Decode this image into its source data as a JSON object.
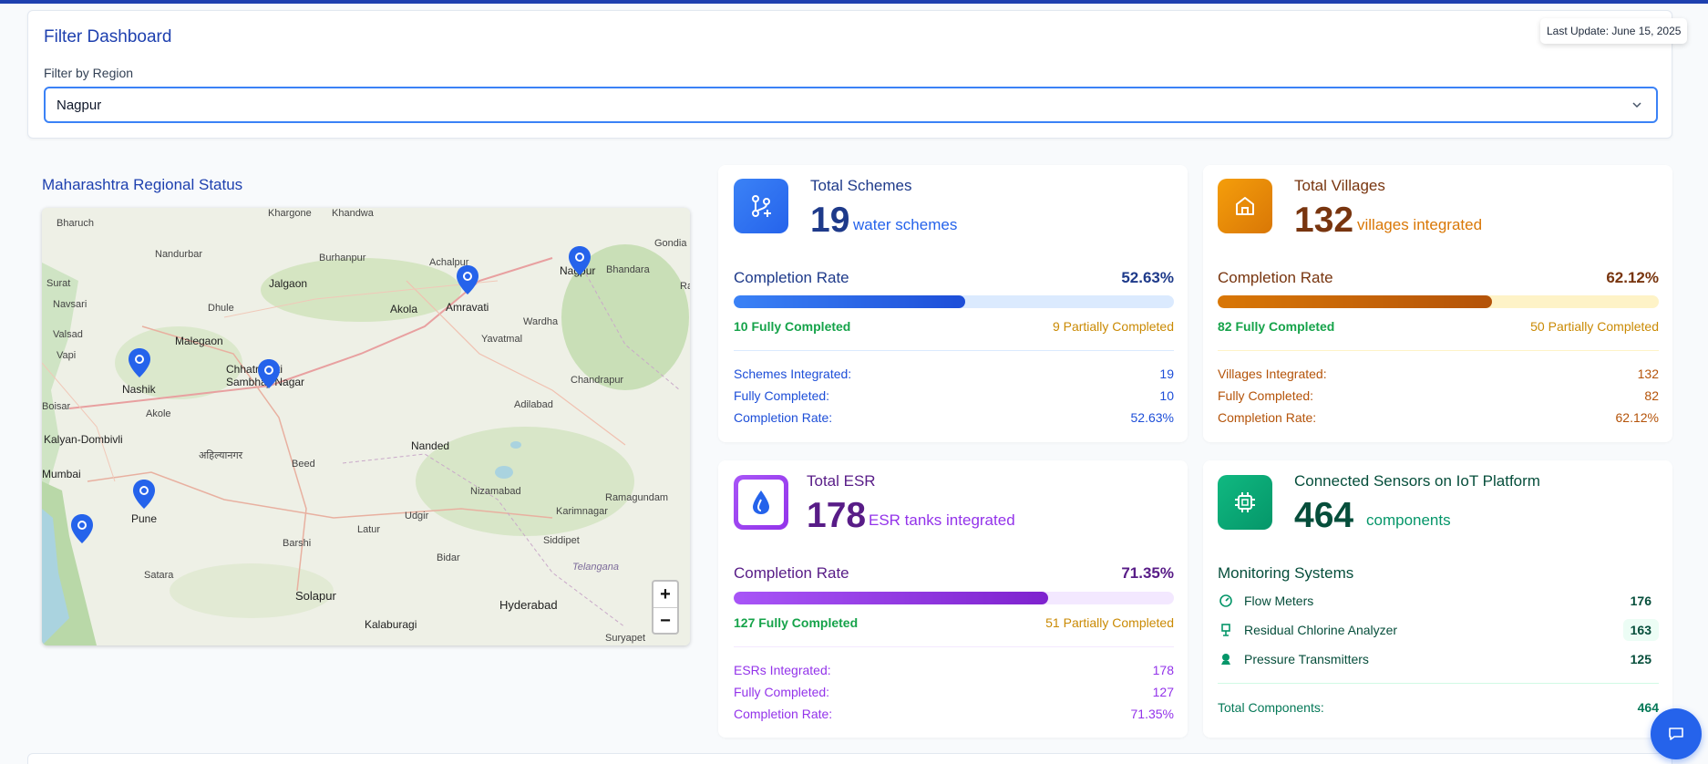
{
  "filter": {
    "title": "Filter Dashboard",
    "region_label": "Filter by Region",
    "region_value": "Nagpur",
    "last_update": "Last Update: June 15, 2025"
  },
  "map": {
    "title": "Maharashtra Regional Status",
    "labels": [
      "Bharuch",
      "Khargone",
      "Khandwa",
      "Nandurbar",
      "Burhanpur",
      "Achalpur",
      "Nagpur",
      "Gondia",
      "Bhandara",
      "Surat",
      "Jalgaon",
      "Navsari",
      "Dhule",
      "Akola",
      "Amravati",
      "Wardha",
      "Valsad",
      "Malegaon",
      "Yavatmal",
      "Vapi",
      "Nashik",
      "Chhatrapati Sambhaji Nagar",
      "Chandrapur",
      "Boisar",
      "Akole",
      "Adilabad",
      "Kalyan-Dombivli",
      "अहिल्यानगर",
      "Nanded",
      "Mumbai",
      "Beed",
      "Nizamabad",
      "Pune",
      "Udgir",
      "Karimnagar",
      "Ramagundam",
      "Barshi",
      "Latur",
      "Siddipet",
      "Satara",
      "Bidar",
      "Telangana",
      "Solapur",
      "Hyderabad",
      "Kalaburagi",
      "Suryapet",
      "Ra"
    ],
    "zoom_in": "+",
    "zoom_out": "−",
    "pins": [
      "Nagpur",
      "Amravati",
      "Nashik",
      "Chhatrapati Sambhaji Nagar",
      "Pune",
      "Mumbai coast"
    ]
  },
  "schemes": {
    "title": "Total Schemes",
    "count": "19",
    "unit": "water schemes",
    "rate_label": "Completion Rate",
    "rate_value": "52.63%",
    "rate_fraction": 0.5263,
    "fully": "10 Fully Completed",
    "partial": "9 Partially Completed",
    "stats": [
      {
        "label": "Schemes Integrated:",
        "value": "19"
      },
      {
        "label": "Fully Completed:",
        "value": "10"
      },
      {
        "label": "Completion Rate:",
        "value": "52.63%"
      }
    ],
    "color": "#2563eb"
  },
  "villages": {
    "title": "Total Villages",
    "count": "132",
    "unit": "villages integrated",
    "rate_label": "Completion Rate",
    "rate_value": "62.12%",
    "rate_fraction": 0.6212,
    "fully": "82 Fully Completed",
    "partial": "50 Partially Completed",
    "stats": [
      {
        "label": "Villages Integrated:",
        "value": "132"
      },
      {
        "label": "Fully Completed:",
        "value": "82"
      },
      {
        "label": "Completion Rate:",
        "value": "62.12%"
      }
    ],
    "color": "#d97706"
  },
  "esr": {
    "title": "Total ESR",
    "count": "178",
    "unit": "ESR tanks integrated",
    "rate_label": "Completion Rate",
    "rate_value": "71.35%",
    "rate_fraction": 0.7135,
    "fully": "127 Fully Completed",
    "partial": "51 Partially Completed",
    "stats": [
      {
        "label": "ESRs Integrated:",
        "value": "178"
      },
      {
        "label": "Fully Completed:",
        "value": "127"
      },
      {
        "label": "Completion Rate:",
        "value": "71.35%"
      }
    ],
    "color": "#9333ea"
  },
  "sensors": {
    "title": "Connected Sensors on IoT Platform",
    "count": "464",
    "unit": "components",
    "monitoring_title": "Monitoring Systems",
    "items": [
      {
        "label": "Flow Meters",
        "value": "176",
        "icon": "gauge-icon"
      },
      {
        "label": "Residual Chlorine Analyzer",
        "value": "163",
        "icon": "analyzer-icon"
      },
      {
        "label": "Pressure Transmitters",
        "value": "125",
        "icon": "pressure-icon"
      }
    ],
    "total_label": "Total Components:",
    "total_value": "464",
    "color": "#059669"
  }
}
